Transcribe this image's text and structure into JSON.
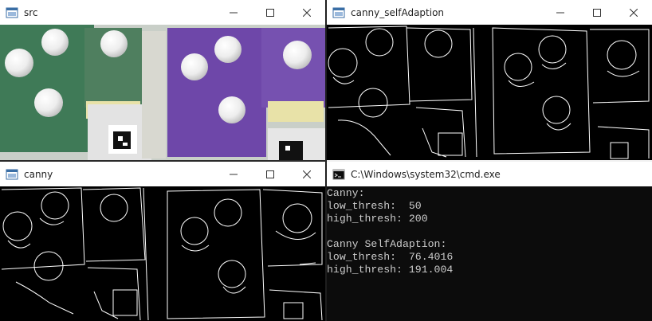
{
  "windows": {
    "src": {
      "title": "src"
    },
    "canny_self": {
      "title": "canny_selfAdaption"
    },
    "canny": {
      "title": "canny"
    },
    "cmd": {
      "title": "C:\\Windows\\system32\\cmd.exe",
      "lines": [
        "Canny:",
        "low_thresh:  50",
        "high_thresh: 200",
        "",
        "Canny SelfAdaption:",
        "low_thresh:  76.4016",
        "high_thresh: 191.004"
      ]
    }
  },
  "icons": {
    "app": "opencv-window-icon",
    "cmd": "console-icon",
    "minimize": "minimize-icon",
    "maximize": "maximize-icon",
    "close": "close-icon"
  },
  "colors": {
    "green_cloth": "#3f7a57",
    "purple_cloth": "#6e47a9",
    "sponge": "#e8e2a8",
    "ball": "#f2f2f2",
    "console_bg": "#0c0c0c",
    "console_text": "#cccccc"
  }
}
